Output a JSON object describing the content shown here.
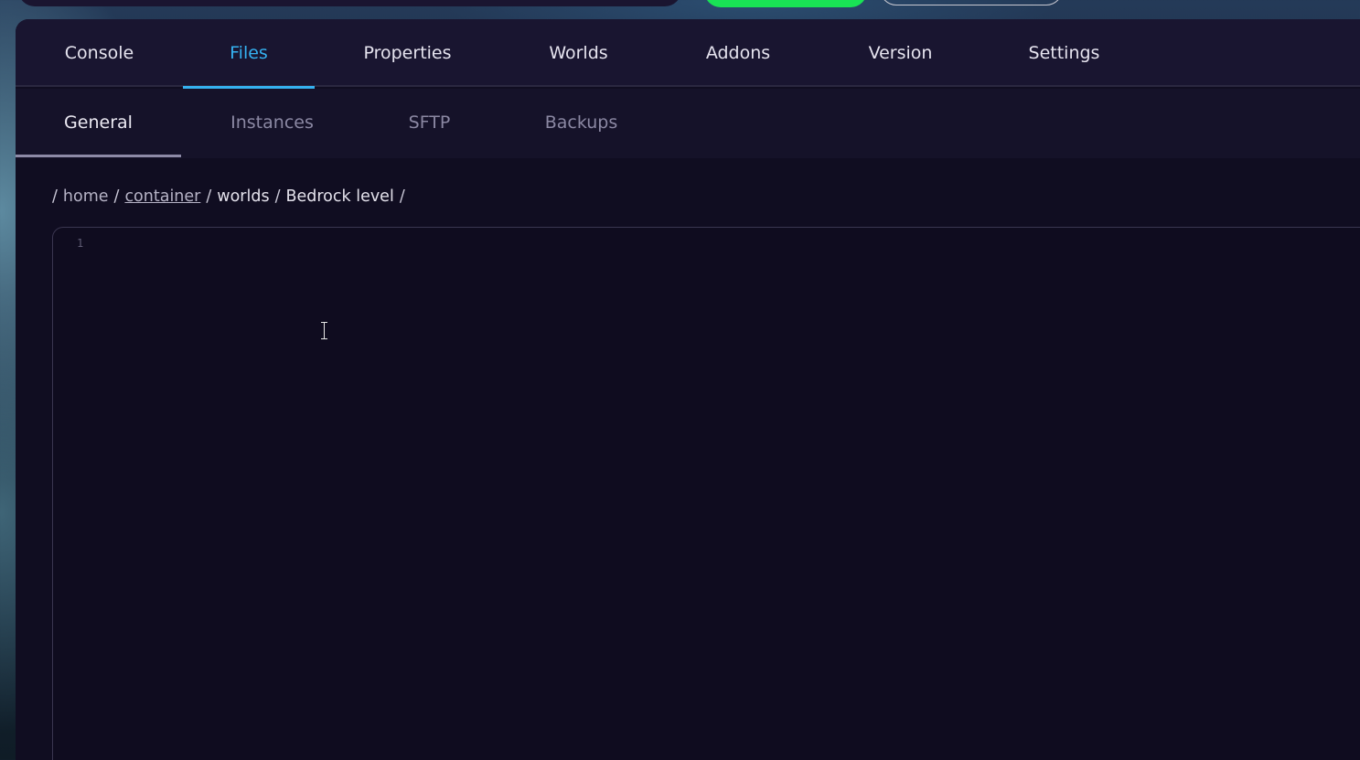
{
  "main_tabs": [
    {
      "label": "Console",
      "active": false
    },
    {
      "label": "Files",
      "active": true
    },
    {
      "label": "Properties",
      "active": false
    },
    {
      "label": "Worlds",
      "active": false
    },
    {
      "label": "Addons",
      "active": false
    },
    {
      "label": "Version",
      "active": false
    },
    {
      "label": "Settings",
      "active": false
    }
  ],
  "sub_tabs": [
    {
      "label": "General",
      "active": true
    },
    {
      "label": "Instances",
      "active": false
    },
    {
      "label": "SFTP",
      "active": false
    },
    {
      "label": "Backups",
      "active": false
    }
  ],
  "breadcrumb": {
    "separator": "/",
    "items": [
      "home",
      "container",
      "worlds",
      "Bedrock level"
    ]
  },
  "editor": {
    "line_numbers": [
      "1"
    ]
  },
  "colors": {
    "accent": "#35b1f0",
    "panel_bg": "#100d21",
    "tab_bar_bg": "#191530",
    "green_button": "#19e355"
  }
}
